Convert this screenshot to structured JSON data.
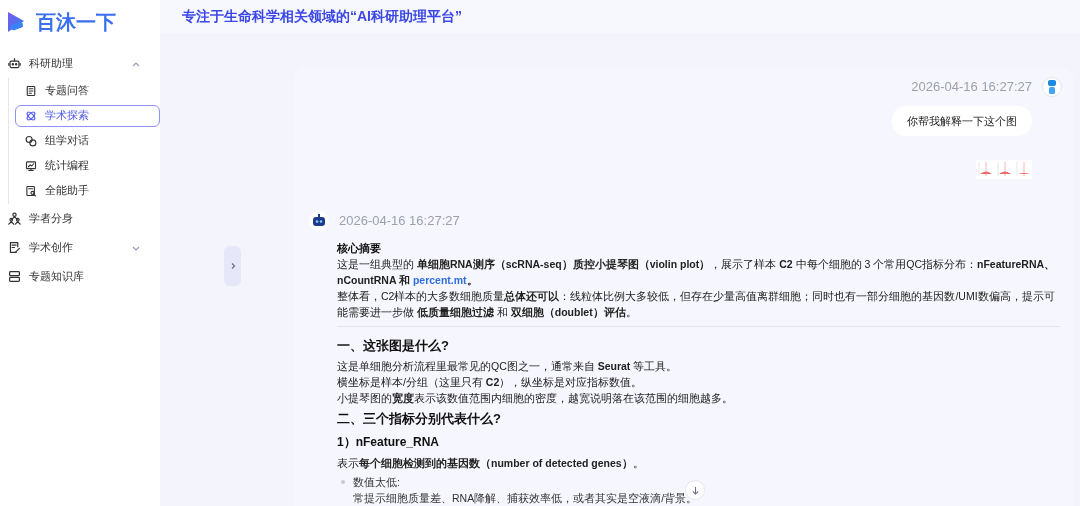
{
  "logo": {
    "text": "百沐一下"
  },
  "header": {
    "title": "专注于生命科学相关领域的“AI科研助理平台”"
  },
  "sidebar": {
    "items": [
      {
        "label": "科研助理",
        "expanded": true,
        "children": [
          {
            "label": "专题问答",
            "selected": false
          },
          {
            "label": "学术探索",
            "selected": true
          },
          {
            "label": "组学对话",
            "selected": false
          },
          {
            "label": "统计编程",
            "selected": false
          },
          {
            "label": "全能助手",
            "selected": false
          }
        ]
      },
      {
        "label": "学者分身",
        "selected": false
      },
      {
        "label": "学术创作",
        "expanded": false
      },
      {
        "label": "专题知识库",
        "selected": false
      }
    ]
  },
  "chat": {
    "user_message": {
      "time": "2026-04-16 16:27:27",
      "text": "你帮我解释一下这个图"
    },
    "assistant_message": {
      "time": "2026-04-16 16:27:27",
      "blocks": [
        {
          "kind": "label",
          "text": "核心摘要"
        },
        {
          "kind": "para",
          "text": "这是一组典型的 **单细胞RNA测序（scRNA-seq）质控小提琴图（violin plot）**，展示了样本 **C2** 中每个细胞的 3 个常用QC指标分布：**nFeatureRNA、nCountRNA 和** ",
          "link": "percent.mt",
          "tail": "**。**"
        },
        {
          "kind": "para",
          "text": "整体看，C2样本的大多数细胞质量**总体还可以**：线粒体比例大多较低，但存在少量高值离群细胞；同时也有一部分细胞的基因数/UMI数偏高，提示可能需要进一步做 **低质量细胞过滤** 和 **双细胞（doublet）评估**。"
        },
        {
          "kind": "rule"
        },
        {
          "kind": "heading",
          "text": "一、这张图是什么?"
        },
        {
          "kind": "para",
          "text": "这是单细胞分析流程里最常见的QC图之一，通常来自 **Seurat** 等工具。"
        },
        {
          "kind": "para",
          "text": "横坐标是样本/分组（这里只有 **C2**），纵坐标是对应指标数值。"
        },
        {
          "kind": "para",
          "text": "小提琴图的**宽度**表示该数值范围内细胞的密度，越宽说明落在该范围的细胞越多。"
        },
        {
          "kind": "heading",
          "text": "二、三个指标分别代表什么?"
        },
        {
          "kind": "subheading",
          "text": "1）nFeature_RNA"
        },
        {
          "kind": "para",
          "text": "表示**每个细胞检测到的基因数（number of detected genes）**。"
        },
        {
          "kind": "bullet",
          "text": "数值太低:",
          "detail": "常提示细胞质量差、RNA降解、捕获效率低，或者其实是空液滴/背景。"
        }
      ]
    }
  }
}
